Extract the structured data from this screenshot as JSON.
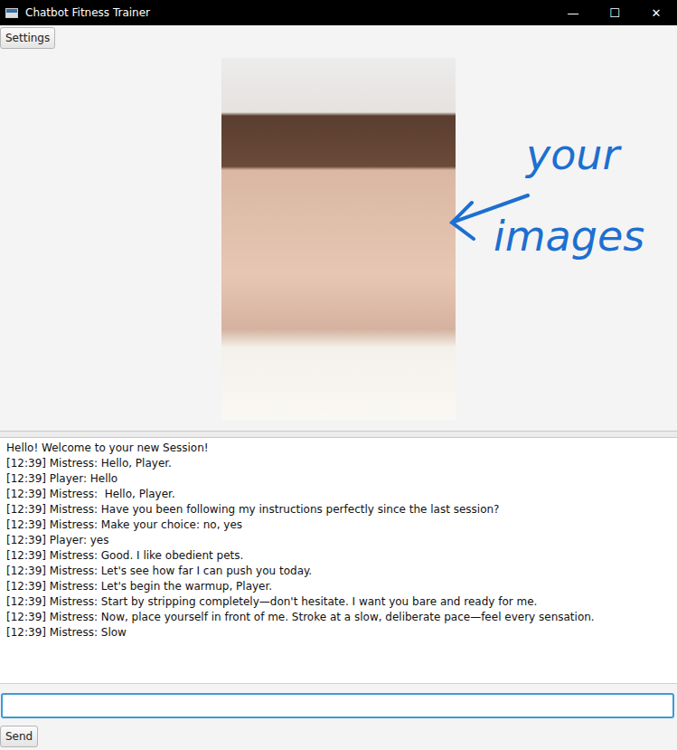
{
  "window": {
    "title": "Chatbot Fitness Trainer",
    "controls": [
      "—",
      "☐",
      "✕"
    ]
  },
  "toolbar": {
    "buttons": [
      "Settings"
    ]
  },
  "annotation": {
    "lines": [
      "your",
      "images"
    ]
  },
  "chat": {
    "lines": [
      "Hello! Welcome to your new Session!",
      "[12:39] Mistress: Hello, Player.",
      "[12:39] Player: Hello",
      "[12:39] Mistress:  Hello, Player.",
      "[12:39] Mistress: Have you been following my instructions perfectly since the last session?",
      "[12:39] Mistress: Make your choice: no, yes",
      "[12:39] Player: yes",
      "[12:39] Mistress: Good. I like obedient pets.",
      "[12:39] Mistress: Let's see how far I can push you today.",
      "[12:39] Mistress: Let's begin the warmup, Player.",
      "[12:39] Mistress: Start by stripping completely—don't hesitate. I want you bare and ready for me.",
      "[12:39] Mistress: Now, place yourself in front of me. Stroke at a slow, deliberate pace—feel every sensation.",
      "[12:39] Mistress: Slow"
    ]
  },
  "input": {
    "value": "",
    "focused": true
  },
  "send": {
    "label": "Send"
  }
}
